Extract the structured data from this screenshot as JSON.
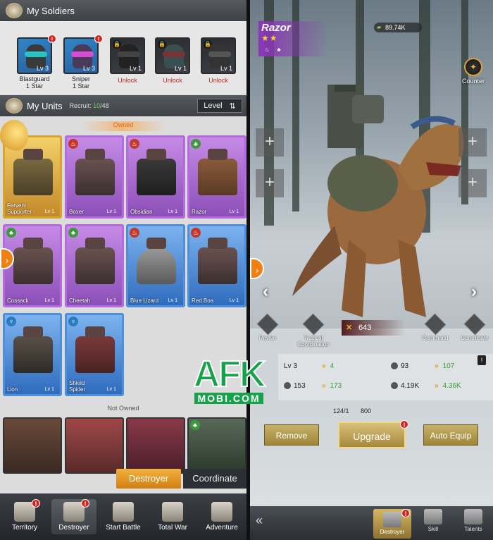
{
  "soldiers": {
    "title": "My Soldiers",
    "items": [
      {
        "name": "Blastguard",
        "rank": "1 Star",
        "level": "Lv 3",
        "state": "owned",
        "alert": "!"
      },
      {
        "name": "Sniper",
        "rank": "1 Star",
        "level": "Lv 3",
        "state": "owned",
        "alert": "!"
      },
      {
        "level": "Lv 1",
        "unlock": "Unlock",
        "state": "locked"
      },
      {
        "level": "Lv 1",
        "unlock": "Unlock",
        "state": "locked"
      },
      {
        "level": "Lv 1",
        "unlock": "Unlock",
        "state": "locked"
      }
    ]
  },
  "units": {
    "title": "My Units",
    "recruit_label": "Recruit:",
    "recruit_count": "10",
    "recruit_total": "/48",
    "sort_label": "Level",
    "sort_icon": "⇅",
    "owned_label": "Owned",
    "not_owned_label": "Not Owned",
    "owned": [
      {
        "name": "Fervent Supporter",
        "level": "Lv 1",
        "rarity": "gold",
        "type": "fire"
      },
      {
        "name": "Boxer",
        "level": "Lv 1",
        "rarity": "purple",
        "type": "fire"
      },
      {
        "name": "Obsidian",
        "level": "Lv 1",
        "rarity": "purple",
        "type": "fire"
      },
      {
        "name": "Razor",
        "level": "Lv 1",
        "rarity": "purple",
        "type": "nature"
      },
      {
        "name": "Cossack",
        "level": "Lv 1",
        "rarity": "purple",
        "type": "nature"
      },
      {
        "name": "Cheetah",
        "level": "Lv 1",
        "rarity": "purple",
        "type": "nature"
      },
      {
        "name": "Blue Lizard",
        "level": "Lv 1",
        "rarity": "blue",
        "type": "fire"
      },
      {
        "name": "Red Boa",
        "level": "Lv 1",
        "rarity": "blue",
        "type": "fire"
      },
      {
        "name": "Lion",
        "level": "Lv 1",
        "rarity": "blue",
        "type": "water"
      },
      {
        "name": "Shield Spider",
        "level": "Lv 1",
        "rarity": "blue",
        "type": "water"
      }
    ],
    "type_glyphs": {
      "fire": "♨",
      "nature": "♣",
      "water": "♆"
    }
  },
  "bottom_tabs": {
    "destroyer": "Destroyer",
    "coordinate": "Coordinate"
  },
  "bottom_nav": [
    {
      "label": "Territory",
      "alert": "!"
    },
    {
      "label": "Destroyer",
      "alert": "!",
      "active": true
    },
    {
      "label": "Start Battle"
    },
    {
      "label": "Total War"
    },
    {
      "label": "Adventure"
    }
  ],
  "detail": {
    "unit_name": "Razor",
    "stars": "★★",
    "power": "89.74K",
    "counter_label": "Counter",
    "battle_power": "643",
    "skills": [
      {
        "label": "Revive"
      },
      {
        "label": "Tactical Coordination"
      },
      {
        "label": "Command"
      },
      {
        "label": "Coordinate"
      }
    ],
    "stats": {
      "level": "Lv 3",
      "level_next": "4",
      "attack": "93",
      "attack_next": "107",
      "defense": "153",
      "defense_next": "173",
      "hp": "4.19K",
      "hp_next": "4.36K"
    },
    "info_icon": "!",
    "cost_a": "124/1",
    "cost_b": "800",
    "buttons": {
      "remove": "Remove",
      "upgrade": "Upgrade",
      "auto_equip": "Auto Equip"
    },
    "nav": [
      {
        "label": "Destroyer",
        "alert": "!",
        "active": true
      },
      {
        "label": "Skill"
      },
      {
        "label": "Talents"
      }
    ]
  },
  "watermark": {
    "afk": "AFK",
    "mobi": "MOBI.COM"
  },
  "colors": {
    "accent_orange": "#d27d12",
    "rarity_gold": "#d4a531",
    "rarity_purple": "#b56bdb",
    "rarity_blue": "#4f8fd9",
    "gain_green": "#2ea62e",
    "alert_red": "#d42222"
  }
}
